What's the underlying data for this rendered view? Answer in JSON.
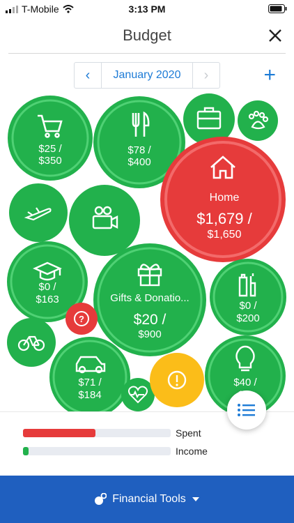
{
  "status": {
    "carrier": "T-Mobile",
    "time": "3:13 PM"
  },
  "header": {
    "title": "Budget"
  },
  "month": {
    "label": "January 2020"
  },
  "colors": {
    "green": "#22b14c",
    "red": "#e63b3b",
    "yellow": "#fbbd19",
    "blue": "#1d7bd6",
    "footer": "#1f5fbf"
  },
  "bubbles": [
    {
      "name": "groceries",
      "icon": "cart-icon",
      "line1": "$25 /",
      "line2": "$350",
      "color": "green"
    },
    {
      "name": "dining",
      "icon": "fork-knife-icon",
      "line1": "$78 /",
      "line2": "$400",
      "color": "green"
    },
    {
      "name": "work",
      "icon": "briefcase-icon",
      "color": "green"
    },
    {
      "name": "pets",
      "icon": "paw-icon",
      "color": "green"
    },
    {
      "name": "home",
      "icon": "house-icon",
      "label": "Home",
      "line1": "$1,679 /",
      "line2": "$1,650",
      "color": "red"
    },
    {
      "name": "travel",
      "icon": "airplane-icon",
      "color": "green"
    },
    {
      "name": "entertainment",
      "icon": "movie-camera-icon",
      "color": "green"
    },
    {
      "name": "education",
      "icon": "graduation-cap-icon",
      "line1": "$0 /",
      "line2": "$163",
      "color": "green"
    },
    {
      "name": "gifts",
      "icon": "gift-icon",
      "label": "Gifts & Donatio...",
      "line1": "$20 /",
      "line2": "$900",
      "color": "green"
    },
    {
      "name": "personal-care",
      "icon": "toiletries-icon",
      "line1": "$0 /",
      "line2": "$200",
      "color": "green"
    },
    {
      "name": "uncategorized",
      "icon": "question-icon",
      "color": "red"
    },
    {
      "name": "bicycle",
      "icon": "bicycle-icon",
      "color": "green"
    },
    {
      "name": "auto",
      "icon": "car-icon",
      "line1": "$71 /",
      "line2": "$184",
      "color": "green"
    },
    {
      "name": "health",
      "icon": "heart-pulse-icon",
      "color": "green"
    },
    {
      "name": "alert",
      "icon": "exclamation-icon",
      "color": "yellow"
    },
    {
      "name": "utilities",
      "icon": "lightbulb-icon",
      "line1": "$40 /",
      "line2": "$...",
      "color": "green"
    }
  ],
  "legend": {
    "spent_label": "Spent",
    "spent_fraction": 0.49,
    "income_label": "Income",
    "income_fraction": 0.04
  },
  "footer": {
    "label": "Financial Tools"
  }
}
